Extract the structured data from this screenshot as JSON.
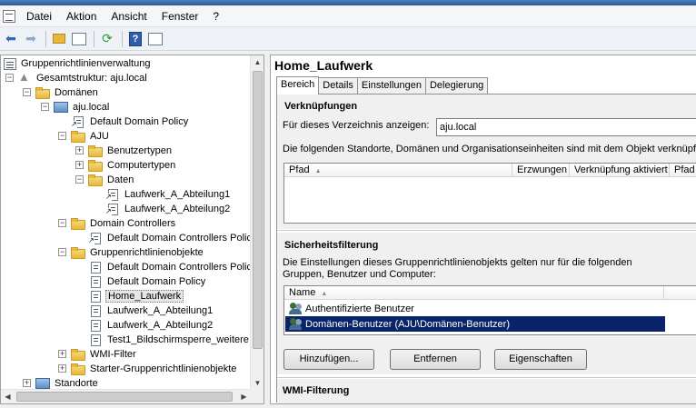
{
  "menubar": {
    "items": [
      "Datei",
      "Aktion",
      "Ansicht",
      "Fenster",
      "?"
    ]
  },
  "toolbar": {
    "icons": [
      "back-arrow-icon",
      "forward-arrow-icon",
      "up-folder-icon",
      "show-hide-tree-icon",
      "refresh-icon",
      "help-icon",
      "properties-icon"
    ]
  },
  "tree": {
    "root": "Gruppenrichtlinienverwaltung",
    "forest": "Gesamtstruktur: aju.local",
    "domains": "Domänen",
    "domain": "aju.local",
    "default_domain_policy_link": "Default Domain Policy",
    "ou_aju": "AJU",
    "benutzertypen": "Benutzertypen",
    "computertypen": "Computertypen",
    "daten": "Daten",
    "link_laufwerk1": "Laufwerk_A_Abteilung1",
    "link_laufwerk2": "Laufwerk_A_Abteilung2",
    "domain_controllers": "Domain Controllers",
    "dc_policy_link": "Default Domain Controllers Policy",
    "gpo_container": "Gruppenrichtlinienobjekte",
    "gpo_dc_policy": "Default Domain Controllers Policy",
    "gpo_domain_policy": "Default Domain Policy",
    "gpo_home": "Home_Laufwerk",
    "gpo_laufwerk1": "Laufwerk_A_Abteilung1",
    "gpo_laufwerk2": "Laufwerk_A_Abteilung2",
    "gpo_test1": "Test1_Bildschirmsperre_weitere",
    "wmi_filter": "WMI-Filter",
    "starter_gpos": "Starter-Gruppenrichtlinienobjekte",
    "standorte": "Standorte"
  },
  "detail": {
    "title": "Home_Laufwerk",
    "tabs": [
      "Bereich",
      "Details",
      "Einstellungen",
      "Delegierung"
    ],
    "links": {
      "title": "Verknüpfungen",
      "show_label": "Für dieses Verzeichnis anzeigen:",
      "dir_value": "aju.local",
      "info": "Die folgenden Standorte, Domänen und Organisationseinheiten sind mit dem Objekt verknüpft:",
      "columns": [
        "Pfad",
        "Erzwungen",
        "Verknüpfung aktiviert",
        "Pfad"
      ]
    },
    "security": {
      "title": "Sicherheitsfilterung",
      "info_line1": "Die Einstellungen dieses Gruppenrichtlinienobjekts gelten nur für die folgenden",
      "info_line2": "Gruppen, Benutzer und Computer:",
      "column_name": "Name",
      "rows": [
        "Authentifizierte Benutzer",
        "Domänen-Benutzer (AJU\\Domänen-Benutzer)"
      ],
      "btn_add": "Hinzufügen...",
      "btn_remove": "Entfernen",
      "btn_props": "Eigenschaften"
    },
    "wmi": {
      "title": "WMI-Filterung"
    }
  }
}
